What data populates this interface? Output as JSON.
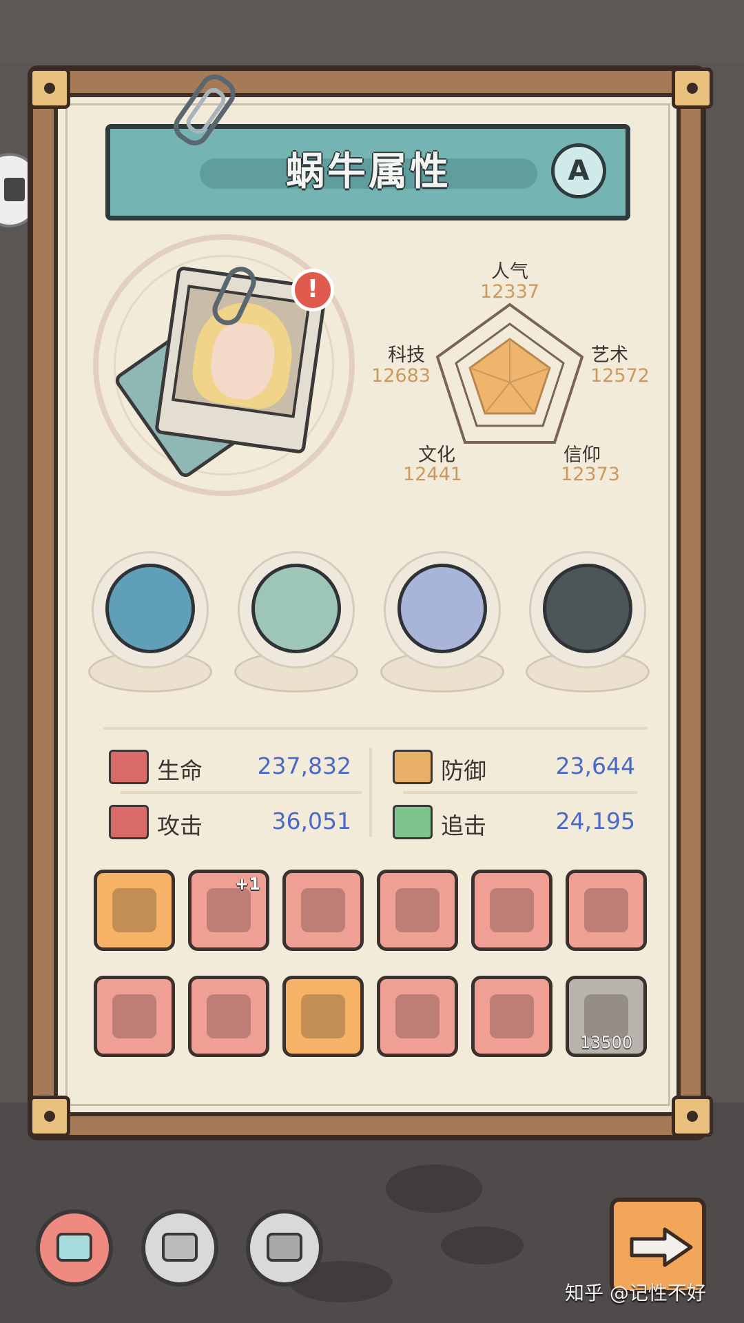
{
  "title": "蜗牛属性",
  "grade": "A",
  "alert_symbol": "!",
  "radar": {
    "popularity": {
      "label": "人气",
      "value": "12337"
    },
    "art": {
      "label": "艺术",
      "value": "12572"
    },
    "faith": {
      "label": "信仰",
      "value": "12373"
    },
    "culture": {
      "label": "文化",
      "value": "12441"
    },
    "tech": {
      "label": "科技",
      "value": "12683"
    }
  },
  "stats": {
    "hp": {
      "label": "生命",
      "value": "237,832"
    },
    "def": {
      "label": "防御",
      "value": "23,644"
    },
    "atk": {
      "label": "攻击",
      "value": "36,051"
    },
    "chase": {
      "label": "追击",
      "value": "24,195"
    }
  },
  "equipment": [
    {
      "icon": "crown-icon",
      "tier": "gold"
    },
    {
      "icon": "dagger-icon",
      "tier": "red",
      "badge": "+1"
    },
    {
      "icon": "slingshot-icon",
      "tier": "red"
    },
    {
      "icon": "mace-icon",
      "tier": "red"
    },
    {
      "icon": "gun-icon",
      "tier": "red"
    },
    {
      "icon": "sword-icon",
      "tier": "red"
    },
    {
      "icon": "blade-icon",
      "tier": "red"
    },
    {
      "icon": "armor-icon",
      "tier": "red"
    },
    {
      "icon": "goggles-icon",
      "tier": "gold"
    },
    {
      "icon": "cloak-icon",
      "tier": "red"
    },
    {
      "icon": "backpack-icon",
      "tier": "red"
    },
    {
      "icon": "rose-icon",
      "tier": "grey",
      "cost": "13500"
    }
  ],
  "watermark": "知乎 @记性不好",
  "colors": {
    "accent_teal": "#74b4b3",
    "value_blue": "#4a68c9",
    "radar_orange": "#c9995e"
  }
}
